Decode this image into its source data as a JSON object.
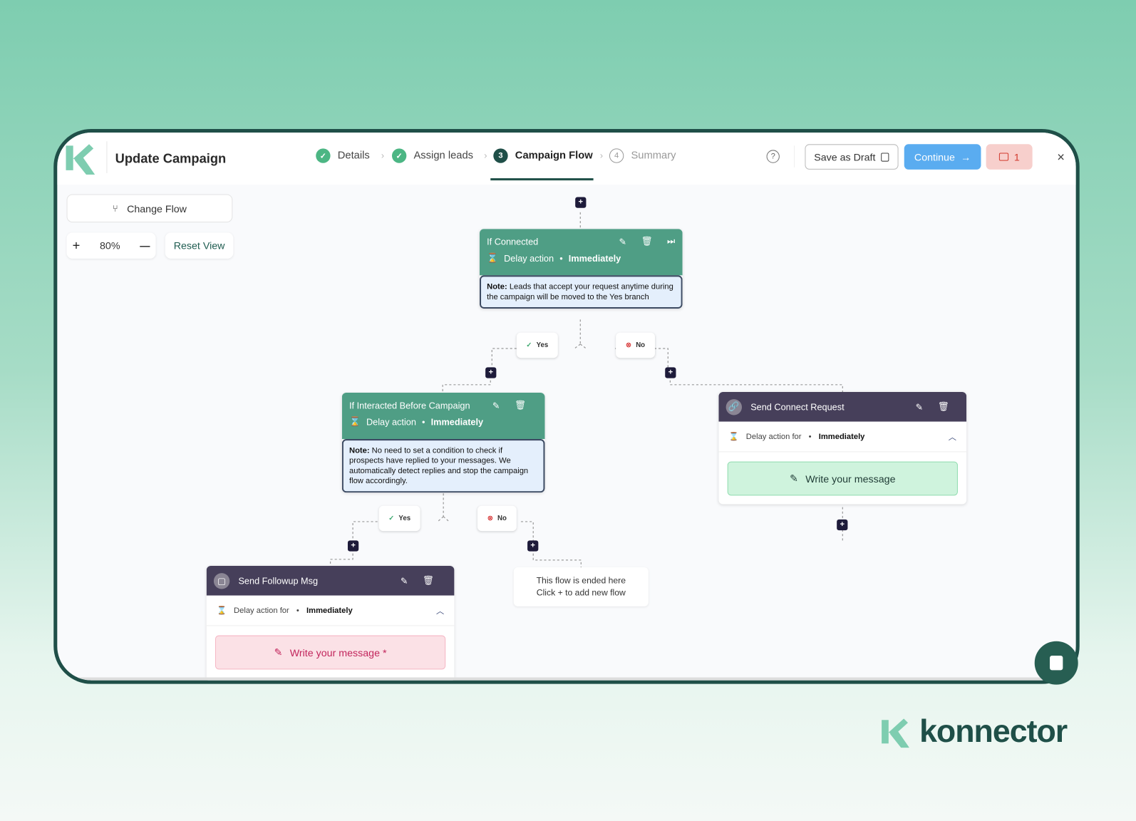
{
  "header": {
    "title": "Update Campaign",
    "steps": [
      {
        "label": "Details",
        "status": "done"
      },
      {
        "label": "Assign leads",
        "status": "done"
      },
      {
        "label": "Campaign Flow",
        "number": "3",
        "status": "active"
      },
      {
        "label": "Summary",
        "number": "4",
        "status": "pending"
      }
    ],
    "save_draft": "Save as Draft",
    "continue": "Continue",
    "comments_count": "1"
  },
  "toolbar": {
    "change_flow": "Change Flow",
    "zoom": "80%",
    "zoom_in": "+",
    "zoom_out": "—",
    "reset_view": "Reset View"
  },
  "nodes": {
    "if_connected": {
      "title": "If Connected",
      "delay_label": "Delay action",
      "delay_value": "Immediately",
      "note_bold": "Note:",
      "note": " Leads that accept your request anytime during the campaign will be moved to the Yes branch"
    },
    "if_interacted": {
      "title": "If Interacted Before Campaign",
      "delay_label": "Delay action",
      "delay_value": "Immediately",
      "note_bold": "Note:",
      "note": " No need to set a condition to check if prospects have replied to your messages. We automatically detect replies and stop the campaign flow accordingly."
    },
    "send_connect": {
      "title": "Send Connect Request",
      "delay_label": "Delay action for",
      "delay_value": "Immediately",
      "message": "Write your message"
    },
    "send_followup": {
      "title": "Send Followup Msg",
      "delay_label": "Delay action for",
      "delay_value": "Immediately",
      "message": "Write your message *"
    },
    "flow_end": {
      "line1": "This flow is ended here",
      "line2": "Click + to add new flow"
    }
  },
  "branches": {
    "yes": "Yes",
    "no": "No"
  },
  "plus": "+",
  "brand": {
    "name": "konnector"
  },
  "colors": {
    "accent_green": "#4f9e85",
    "dark_node": "#463f5a",
    "continue_blue": "#5aacf0",
    "comment_red": "#f7cfcc",
    "frame": "#1f4f48"
  }
}
